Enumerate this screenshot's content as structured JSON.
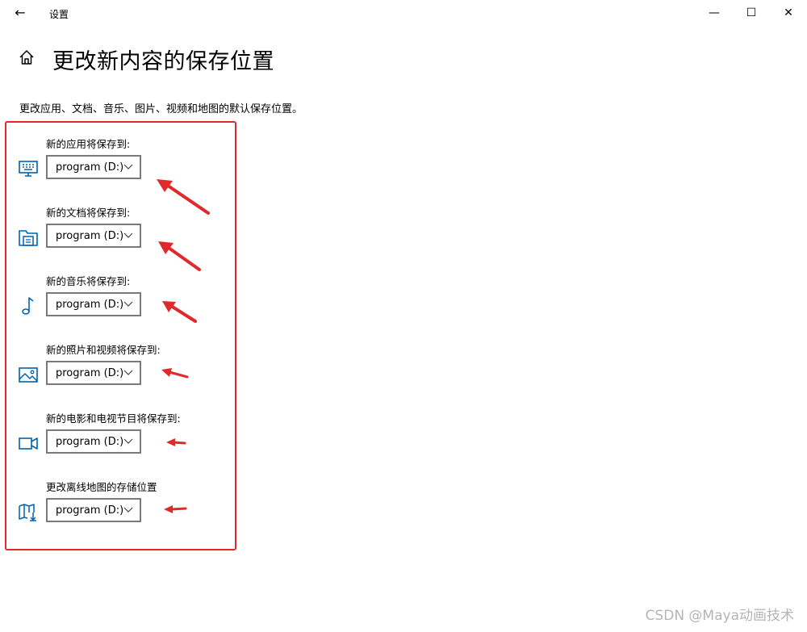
{
  "window": {
    "back_glyph": "←",
    "title": "设置",
    "minimize_glyph": "—",
    "maximize_glyph": "☐",
    "close_glyph": "✕"
  },
  "page": {
    "title": "更改新内容的保存位置",
    "description": "更改应用、文档、音乐、图片、视频和地图的默认保存位置。"
  },
  "sections": [
    {
      "label": "新的应用将保存到:",
      "value": "program (D:)",
      "icon": "monitor-icon"
    },
    {
      "label": "新的文档将保存到:",
      "value": "program (D:)",
      "icon": "documents-folder-icon"
    },
    {
      "label": "新的音乐将保存到:",
      "value": "program (D:)",
      "icon": "music-note-icon"
    },
    {
      "label": "新的照片和视频将保存到:",
      "value": "program (D:)",
      "icon": "picture-icon"
    },
    {
      "label": "新的电影和电视节目将保存到:",
      "value": "program (D:)",
      "icon": "video-camera-icon"
    },
    {
      "label": "更改离线地图的存储位置",
      "value": "program (D:)",
      "icon": "map-download-icon"
    }
  ],
  "annotation": {
    "highlight_color": "#e0292b",
    "arrow_color": "#e0292b"
  },
  "watermark": "CSDN @Maya动画技术",
  "colors": {
    "accent": "#0063b1",
    "border": "#7a7a7a"
  }
}
